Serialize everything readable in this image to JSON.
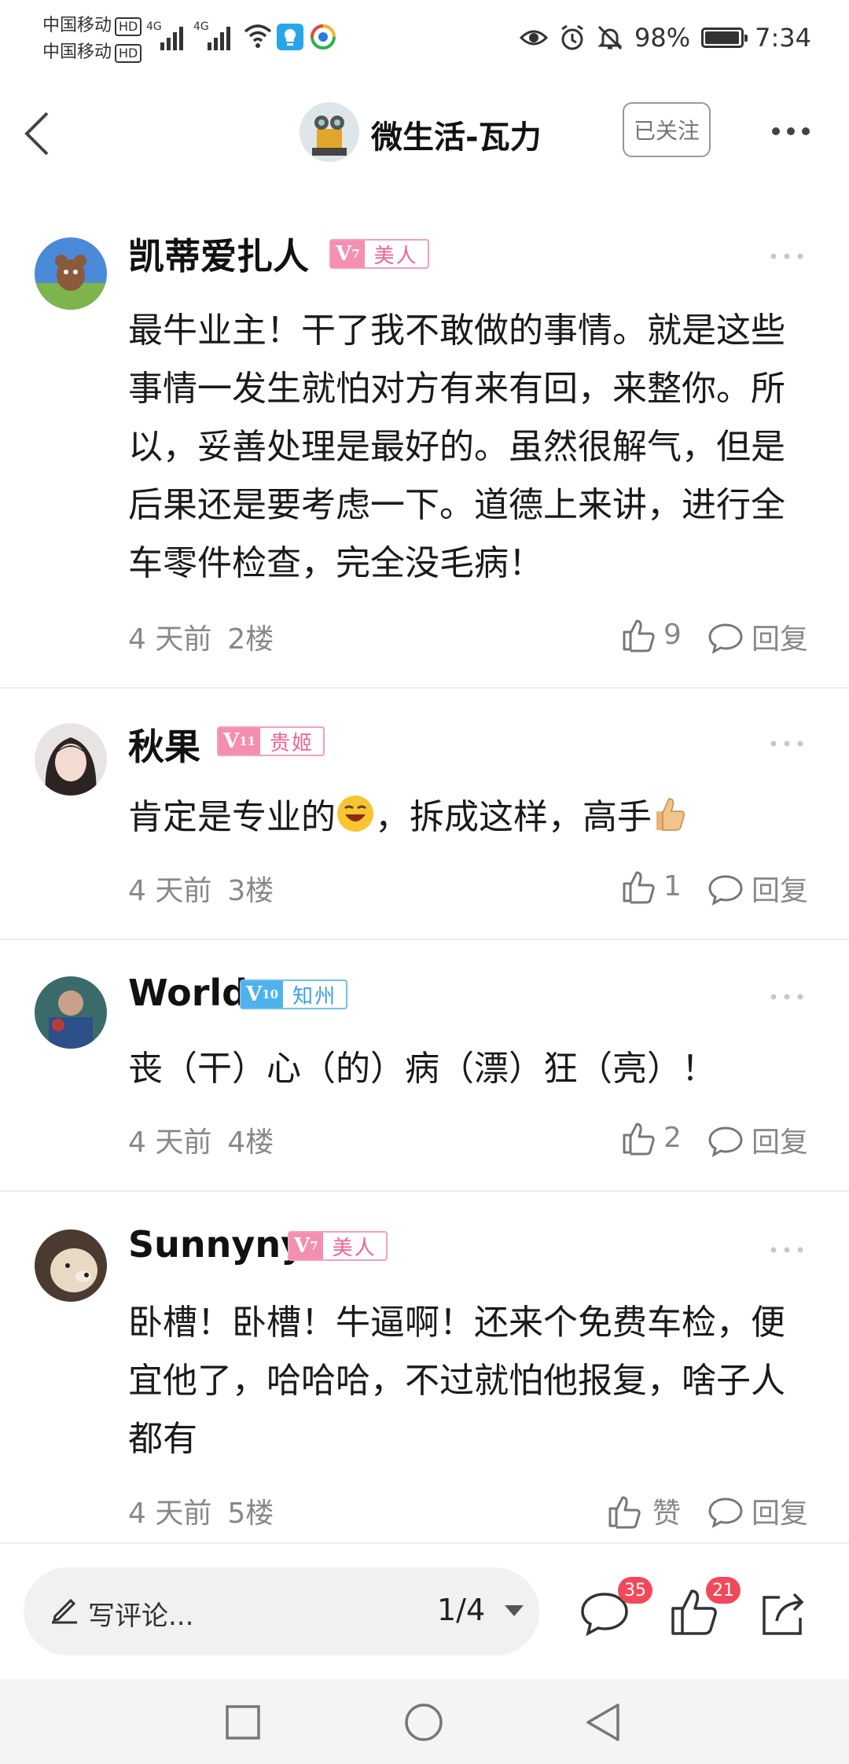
{
  "status_bar": {
    "carrier1": "中国移动",
    "carrier2": "中国移动",
    "hd_label": "HD",
    "network1": "4G",
    "network2": "4G",
    "battery_text": "98%",
    "battery_level": 0.98,
    "time": "7:34"
  },
  "header": {
    "title": "微生活-瓦力",
    "follow_label": "已关注"
  },
  "comments": [
    {
      "user": "凯蒂爱扎人",
      "level_prefix": "V",
      "level": "7",
      "title": "美人",
      "text": "最牛业主！干了我不敢做的事情。就是这些事情一发生就怕对方有来有回，来整你。所以，妥善处理是最好的。虽然很解气，但是后果还是要考虑一下。道德上来讲，进行全车零件检查，完全没毛病！",
      "time": "4 天前",
      "floor": "2楼",
      "likes": "9",
      "reply": "回复"
    },
    {
      "user": "秋果",
      "level_prefix": "V",
      "level": "11",
      "title": "贵姬",
      "text_before": "肯定是专业的",
      "text_mid": "，拆成这样，高手",
      "time": "4 天前",
      "floor": "3楼",
      "likes": "1",
      "reply": "回复"
    },
    {
      "user": "World",
      "level_prefix": "V",
      "level": "10",
      "title": "知州",
      "text": "丧（干）心（的）病（漂）狂（亮）！",
      "time": "4 天前",
      "floor": "4楼",
      "likes": "2",
      "reply": "回复"
    },
    {
      "user": "Sunnyny",
      "level_prefix": "V",
      "level": "7",
      "title": "美人",
      "text": "卧槽！卧槽！牛逼啊！还来个免费车检，便宜他了，哈哈哈，不过就怕他报复，啥子人都有",
      "time": "4 天前",
      "floor": "5楼",
      "likes": "赞",
      "reply": "回复"
    }
  ],
  "bottom_bar": {
    "placeholder": "写评论...",
    "page_indicator": "1/4",
    "comment_count": "35",
    "like_count": "21"
  },
  "icons": {
    "back": "back-arrow-icon",
    "more": "more-dots-icon",
    "like": "thumbs-up-icon",
    "reply": "speech-bubble-icon",
    "pencil": "pencil-icon",
    "share": "share-icon",
    "nav_recent": "square-icon",
    "nav_home": "circle-icon",
    "nav_back": "triangle-back-icon"
  }
}
